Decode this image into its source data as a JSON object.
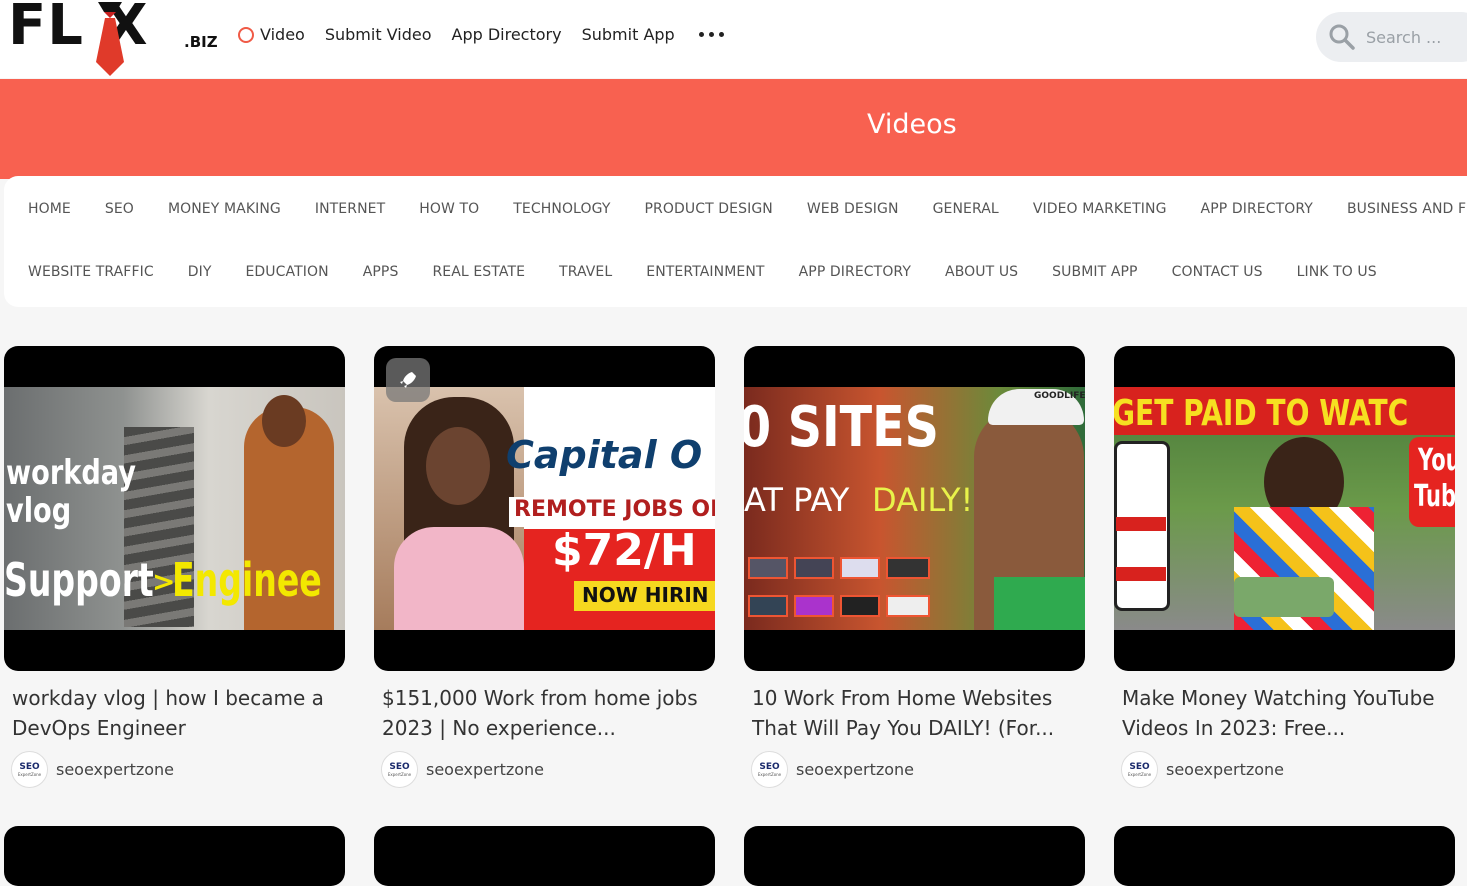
{
  "header": {
    "logo_text": "FL X",
    "logo_suffix": ".BIZ",
    "nav": [
      {
        "label": "Video"
      },
      {
        "label": "Submit Video"
      },
      {
        "label": "App Directory"
      },
      {
        "label": "Submit App"
      }
    ],
    "search_placeholder": "Search ..."
  },
  "banner": {
    "title": "Videos"
  },
  "categories": {
    "row1": [
      "HOME",
      "SEO",
      "MONEY MAKING",
      "INTERNET",
      "HOW TO",
      "TECHNOLOGY",
      "PRODUCT DESIGN",
      "WEB DESIGN",
      "GENERAL",
      "VIDEO MARKETING",
      "APP DIRECTORY",
      "BUSINESS AND FINANCE"
    ],
    "row2": [
      "WEBSITE TRAFFIC",
      "DIY",
      "EDUCATION",
      "APPS",
      "REAL ESTATE",
      "TRAVEL",
      "ENTERTAINMENT",
      "APP DIRECTORY",
      "ABOUT US",
      "SUBMIT APP",
      "CONTACT US",
      "LINK TO US"
    ]
  },
  "videos": [
    {
      "title": "workday vlog | how I became a DevOps Engineer",
      "author": "seoexpertzone",
      "thumb_text": [
        "workday",
        "vlog",
        "Support",
        ">",
        "Enginee"
      ]
    },
    {
      "title": "$151,000 Work from home jobs 2023 | No experience...",
      "author": "seoexpertzone",
      "thumb_text": [
        "Capital O",
        "REMOTE JOBS OP",
        "$72/H",
        "NOW HIRIN"
      ]
    },
    {
      "title": "10 Work From Home Websites That Will Pay You DAILY! (For...",
      "author": "seoexpertzone",
      "thumb_text": [
        "0 SITES",
        "AT PAY",
        "DAILY!",
        "GOODLIFE"
      ]
    },
    {
      "title": "Make Money Watching YouTube Videos In 2023: Free...",
      "author": "seoexpertzone",
      "thumb_text": [
        "GET PAID TO WATC",
        "You",
        "Tub"
      ]
    }
  ],
  "avatar": {
    "main": "SEO",
    "sub": "ExpertZone"
  },
  "colors": {
    "accent": "#f86150",
    "background": "#f6f6f6"
  }
}
